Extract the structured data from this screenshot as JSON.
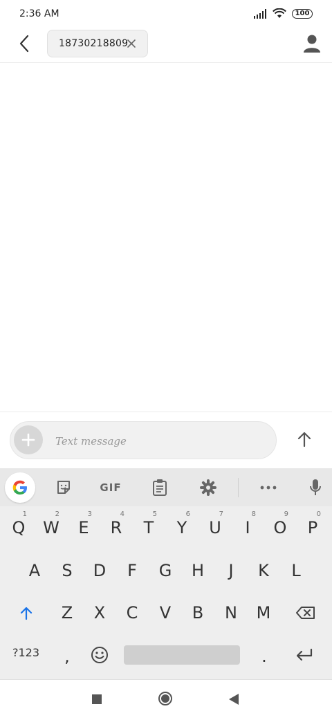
{
  "status_bar": {
    "time": "2:36 AM",
    "battery": "100",
    "icons": [
      "signal-icon",
      "wifi-icon",
      "battery-icon"
    ]
  },
  "header": {
    "recipient": "18730218809",
    "icons": [
      "back-arrow-icon",
      "close-icon",
      "contact-icon"
    ]
  },
  "compose": {
    "placeholder": "Text message",
    "icons": [
      "plus-icon",
      "send-arrow-icon"
    ]
  },
  "keyboard": {
    "toolbar": {
      "google": "G",
      "gif": "GIF",
      "icons": [
        "google-icon",
        "sticker-icon",
        "gif-icon",
        "clipboard-icon",
        "settings-icon",
        "more-icon",
        "mic-icon"
      ]
    },
    "row1": [
      "Q",
      "W",
      "E",
      "R",
      "T",
      "Y",
      "U",
      "I",
      "O",
      "P"
    ],
    "row1_hints": [
      "1",
      "2",
      "3",
      "4",
      "5",
      "6",
      "7",
      "8",
      "9",
      "0"
    ],
    "row2": [
      "A",
      "S",
      "D",
      "F",
      "G",
      "H",
      "J",
      "K",
      "L"
    ],
    "row3": [
      "Z",
      "X",
      "C",
      "V",
      "B",
      "N",
      "M"
    ],
    "bottom": {
      "symbols": "?123",
      "comma": ",",
      "period": "."
    },
    "accent_color": "#1a73e8"
  },
  "nav_bar": {
    "icons": [
      "recents-icon",
      "home-icon",
      "back-icon"
    ]
  }
}
